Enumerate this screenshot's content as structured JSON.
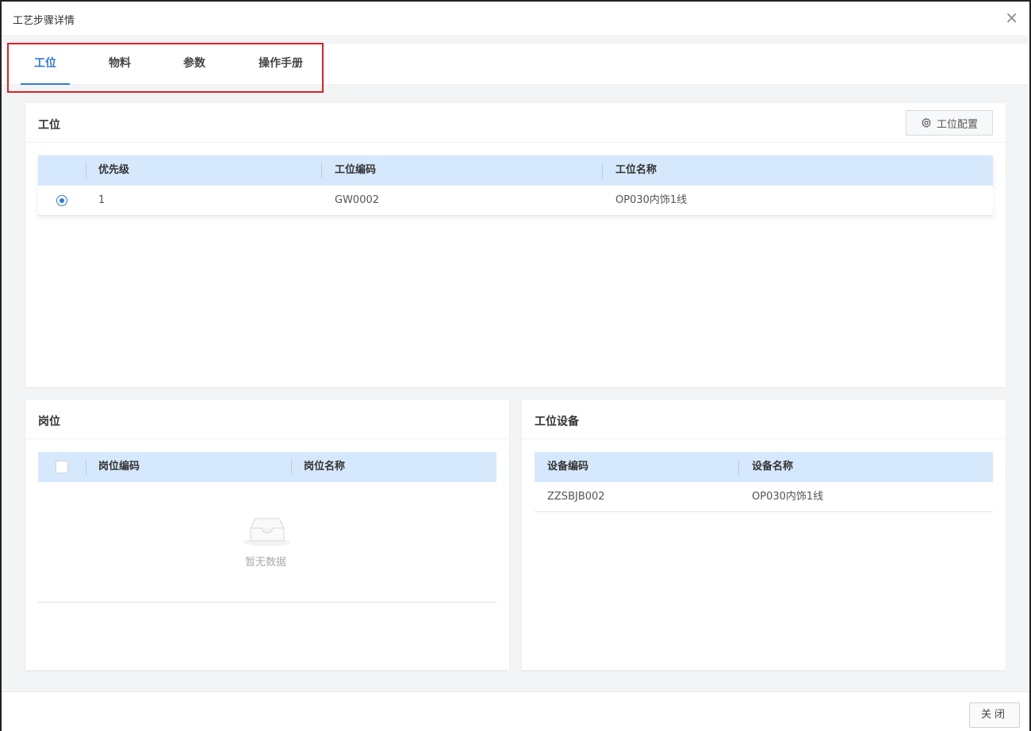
{
  "dialog": {
    "title": "工艺步骤详情",
    "close_icon": "×"
  },
  "tabs": [
    {
      "label": "工位",
      "active": true
    },
    {
      "label": "物料",
      "active": false
    },
    {
      "label": "参数",
      "active": false
    },
    {
      "label": "操作手册",
      "active": false
    }
  ],
  "workstation": {
    "title": "工位",
    "config_button": "工位配置",
    "columns": [
      "优先级",
      "工位编码",
      "工位名称"
    ],
    "rows": [
      {
        "selected": true,
        "priority": "1",
        "code": "GW0002",
        "name": "OP030内饰1线"
      }
    ]
  },
  "post": {
    "title": "岗位",
    "columns": [
      "岗位编码",
      "岗位名称"
    ],
    "rows": [],
    "empty_text": "暂无数据"
  },
  "equipment": {
    "title": "工位设备",
    "columns": [
      "设备编码",
      "设备名称"
    ],
    "rows": [
      {
        "code": "ZZSBJB002",
        "name": "OP030内饰1线"
      }
    ]
  },
  "footer": {
    "close_button": "关闭"
  },
  "colors": {
    "accent": "#2f7bd6",
    "table_header": "#d6e8fb",
    "highlight": "#e02020"
  }
}
